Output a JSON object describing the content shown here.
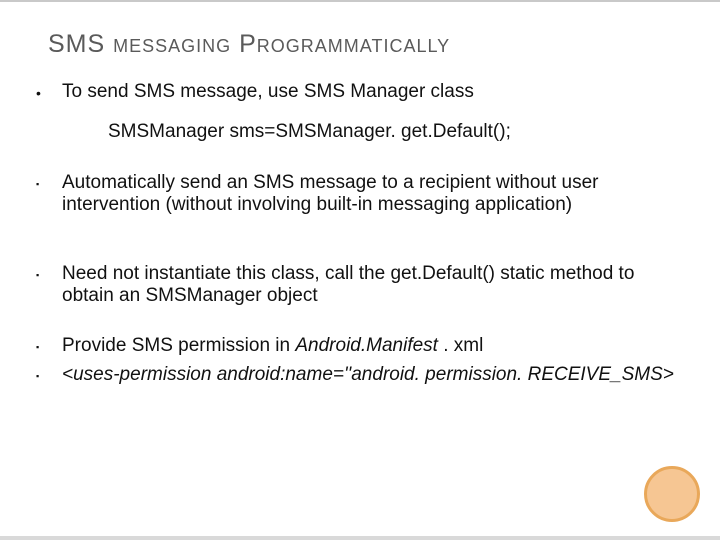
{
  "title": {
    "part1": "SMS",
    "part2": " messaging ",
    "part3": "P",
    "part4": "rogrammatically"
  },
  "items": [
    {
      "bullet": "•",
      "text": "To send SMS message, use SMS Manager class"
    }
  ],
  "code": "SMSManager sms=SMSManager. get.Default();",
  "items2": [
    {
      "bullet": "▪",
      "text": " Automatically send an SMS message to a recipient without user intervention (without involving built-in messaging application)"
    }
  ],
  "items3": [
    {
      "bullet": "▪",
      "text": "Need not instantiate this class, call the get.Default() static method to obtain an SMSManager object"
    }
  ],
  "items4": [
    {
      "bullet": "▪",
      "text_pre": "Provide SMS permission in ",
      "text_it": "Android.Manifest",
      "text_post": " . xml"
    },
    {
      "bullet": "▪",
      "text": "<uses-permission android:name=''android. permission. RECEIVE_SMS>"
    }
  ]
}
